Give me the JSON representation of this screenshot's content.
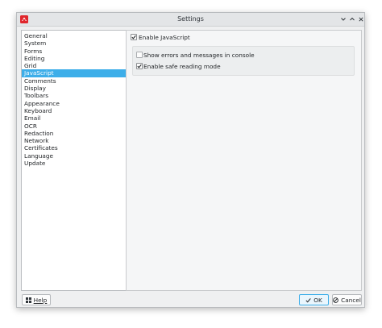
{
  "window": {
    "title": "Settings",
    "controls": [
      "minimize-icon",
      "maximize-icon",
      "close-icon"
    ]
  },
  "sidebar": {
    "selected_index": 6,
    "items": [
      {
        "label": "General"
      },
      {
        "label": "System"
      },
      {
        "label": "Forms"
      },
      {
        "label": "Editing"
      },
      {
        "label": "Grid"
      },
      {
        "label": "JavaScript"
      },
      {
        "label": "Comments"
      },
      {
        "label": "Display"
      },
      {
        "label": "Toolbars"
      },
      {
        "label": "Appearance"
      },
      {
        "label": "Keyboard"
      },
      {
        "label": "Email"
      },
      {
        "label": "OCR"
      },
      {
        "label": "Redaction"
      },
      {
        "label": "Network"
      },
      {
        "label": "Certificates"
      },
      {
        "label": "Language"
      },
      {
        "label": "Update"
      }
    ]
  },
  "javascript": {
    "enable": {
      "label": "Enable JavaScript",
      "checked": true
    },
    "show_errors": {
      "label": "Show errors and  messages in console",
      "checked": false
    },
    "safe_reading": {
      "label": "Enable safe reading mode",
      "checked": true
    }
  },
  "footer": {
    "help_label": "Help",
    "ok_label": "OK",
    "cancel_label": "Cancel"
  },
  "colors": {
    "accent": "#3daee9",
    "app_icon": "#e0262c"
  }
}
